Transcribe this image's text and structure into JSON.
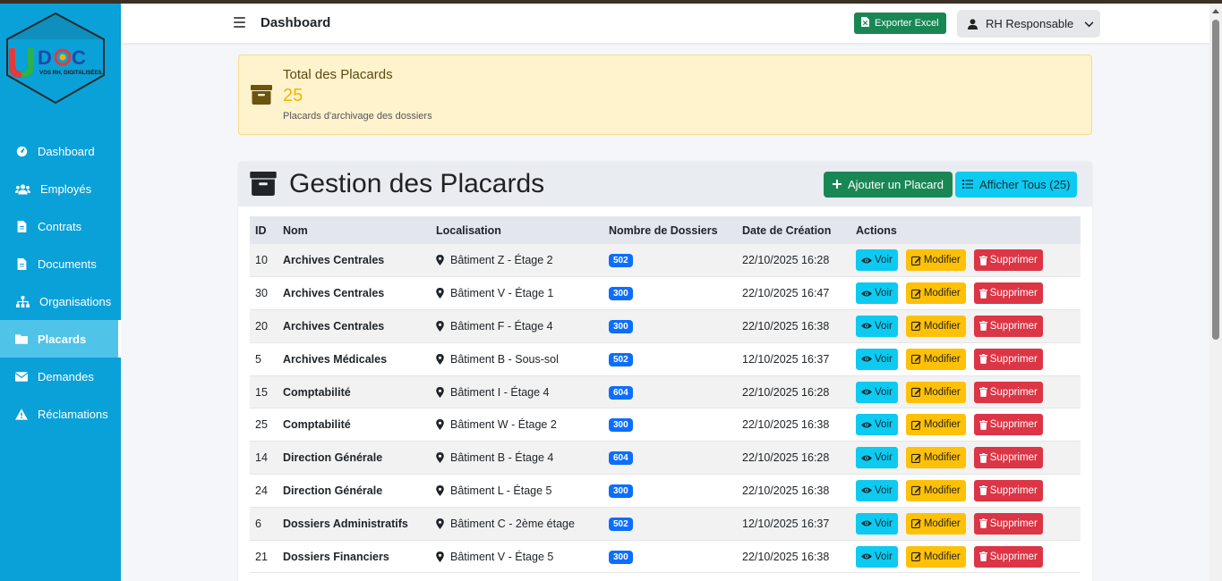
{
  "logo": {
    "brand": "DOC",
    "tagline": "VOS RH, DIGITALISÉES."
  },
  "sidebar": {
    "items": [
      {
        "label": "Dashboard",
        "icon": "gauge-icon"
      },
      {
        "label": "Employés",
        "icon": "users-icon"
      },
      {
        "label": "Contrats",
        "icon": "file-icon"
      },
      {
        "label": "Documents",
        "icon": "file-icon"
      },
      {
        "label": "Organisations",
        "icon": "sitemap-icon"
      },
      {
        "label": "Placards",
        "icon": "folder-icon",
        "active": true
      },
      {
        "label": "Demandes",
        "icon": "envelope-icon"
      },
      {
        "label": "Réclamations",
        "icon": "warning-icon"
      }
    ]
  },
  "topbar": {
    "title": "Dashboard",
    "export_label": "Exporter Excel",
    "user_label": "RH Responsable"
  },
  "stat": {
    "title": "Total des Placards",
    "value": "25",
    "subtitle": "Placards d'archivage des dossiers"
  },
  "card": {
    "title": "Gestion des Placards",
    "add_label": "Ajouter un Placard",
    "show_all_label": "Afficher Tous (25)"
  },
  "table": {
    "headers": [
      "ID",
      "Nom",
      "Localisation",
      "Nombre de Dossiers",
      "Date de Création",
      "Actions"
    ],
    "action_labels": {
      "view": "Voir",
      "edit": "Modifier",
      "delete": "Supprimer"
    },
    "rows": [
      {
        "id": "10",
        "nom": "Archives Centrales",
        "loc": "Bâtiment Z - Étage 2",
        "nb": "502",
        "date": "22/10/2025 16:28"
      },
      {
        "id": "30",
        "nom": "Archives Centrales",
        "loc": "Bâtiment V - Étage 1",
        "nb": "300",
        "date": "22/10/2025 16:47"
      },
      {
        "id": "20",
        "nom": "Archives Centrales",
        "loc": "Bâtiment F - Étage 4",
        "nb": "300",
        "date": "22/10/2025 16:38"
      },
      {
        "id": "5",
        "nom": "Archives Médicales",
        "loc": "Bâtiment B - Sous-sol",
        "nb": "502",
        "date": "12/10/2025 16:37"
      },
      {
        "id": "15",
        "nom": "Comptabilité",
        "loc": "Bâtiment I - Étage 4",
        "nb": "604",
        "date": "22/10/2025 16:28"
      },
      {
        "id": "25",
        "nom": "Comptabilité",
        "loc": "Bâtiment W - Étage 2",
        "nb": "300",
        "date": "22/10/2025 16:38"
      },
      {
        "id": "14",
        "nom": "Direction Générale",
        "loc": "Bâtiment B - Étage 4",
        "nb": "604",
        "date": "22/10/2025 16:28"
      },
      {
        "id": "24",
        "nom": "Direction Générale",
        "loc": "Bâtiment L - Étage 5",
        "nb": "300",
        "date": "22/10/2025 16:38"
      },
      {
        "id": "6",
        "nom": "Dossiers Administratifs",
        "loc": "Bâtiment C - 2ème étage",
        "nb": "502",
        "date": "12/10/2025 16:37"
      },
      {
        "id": "21",
        "nom": "Dossiers Financiers",
        "loc": "Bâtiment V - Étage 5",
        "nb": "300",
        "date": "22/10/2025 16:38"
      }
    ]
  },
  "colors": {
    "sidebar": "#0aa1d8",
    "sidebar_active": "#4fc3e8",
    "success": "#198754",
    "info": "#0dcaf0",
    "warning": "#ffc107",
    "danger": "#dc3545",
    "badge": "#0d6efd"
  }
}
